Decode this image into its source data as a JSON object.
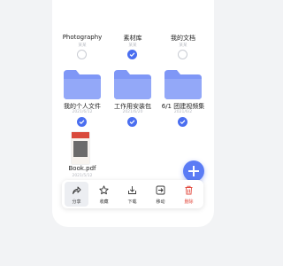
{
  "colors": {
    "accent": "#4a6ef0",
    "folder": "#7f97f6",
    "danger": "#e24b3f",
    "meta": "#b5b8bf"
  },
  "grid": {
    "row1": [
      {
        "name": "Photography",
        "meta": "某某",
        "checked": false
      },
      {
        "name": "素材库",
        "meta": "某某",
        "checked": true
      },
      {
        "name": "我的文档",
        "meta": "某某",
        "checked": false
      }
    ],
    "row2": [
      {
        "name": "我的个人文件",
        "date": "2021/6/12",
        "checked": true
      },
      {
        "name": "工作用安装包",
        "date": "2021/6/20",
        "checked": true
      },
      {
        "name": "6/1 团建视频集",
        "date": "2021/6/2",
        "checked": true
      }
    ],
    "row3": [
      {
        "name": "Book.pdf",
        "date": "2021/5/12",
        "checked": true
      }
    ]
  },
  "fab": {
    "icon": "plus-icon"
  },
  "toolbar": {
    "items": [
      {
        "label": "分享",
        "icon": "share-icon",
        "active": true
      },
      {
        "label": "收藏",
        "icon": "star-icon",
        "active": false
      },
      {
        "label": "下载",
        "icon": "download-icon",
        "active": false
      },
      {
        "label": "移动",
        "icon": "move-icon",
        "active": false
      },
      {
        "label": "删除",
        "icon": "trash-icon",
        "active": false,
        "danger": true
      }
    ]
  }
}
